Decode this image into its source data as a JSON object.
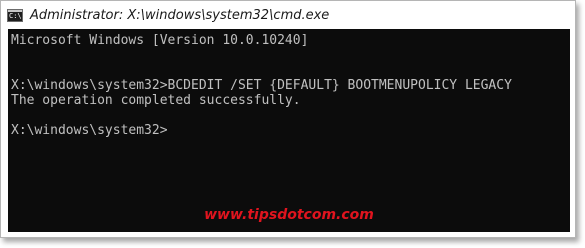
{
  "window": {
    "title": "Administrator: X:\\windows\\system32\\cmd.exe",
    "icon": "cmd-icon",
    "icon_glyph": "C:\\"
  },
  "console": {
    "lines": [
      "Microsoft Windows [Version 10.0.10240]",
      "",
      "",
      "X:\\windows\\system32>BCDEDIT /SET {DEFAULT} BOOTMENUPOLICY LEGACY",
      "The operation completed successfully.",
      "",
      "X:\\windows\\system32>"
    ],
    "background_color": "#0c0c0c",
    "text_color": "#c0c0c0"
  },
  "watermark": {
    "text": "www.tipsdotcom.com",
    "color": "#e0141e"
  }
}
